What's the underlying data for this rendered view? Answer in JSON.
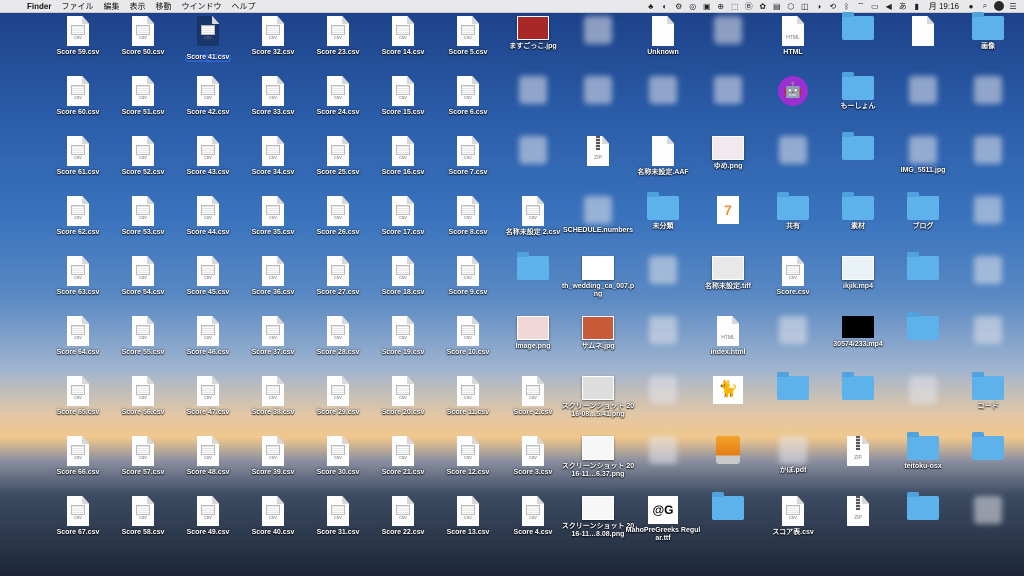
{
  "menubar": {
    "apple": "",
    "app": "Finder",
    "items": [
      "ファイル",
      "編集",
      "表示",
      "移動",
      "ウインドウ",
      "ヘルプ"
    ],
    "clock": "月 19:16"
  },
  "desktop": {
    "items": [
      {
        "label": "Score 59.csv",
        "kind": "csv"
      },
      {
        "label": "Score 50.csv",
        "kind": "csv"
      },
      {
        "label": "Score 41.csv",
        "kind": "csv",
        "selected": true
      },
      {
        "label": "Score 32.csv",
        "kind": "csv"
      },
      {
        "label": "Score 23.csv",
        "kind": "csv"
      },
      {
        "label": "Score 14.csv",
        "kind": "csv"
      },
      {
        "label": "Score 5.csv",
        "kind": "csv"
      },
      {
        "label": "Score 60.csv",
        "kind": "csv"
      },
      {
        "label": "Score 51.csv",
        "kind": "csv"
      },
      {
        "label": "Score 42.csv",
        "kind": "csv"
      },
      {
        "label": "Score 33.csv",
        "kind": "csv"
      },
      {
        "label": "Score 24.csv",
        "kind": "csv"
      },
      {
        "label": "Score 15.csv",
        "kind": "csv"
      },
      {
        "label": "Score 6.csv",
        "kind": "csv"
      },
      {
        "label": "Score 61.csv",
        "kind": "csv"
      },
      {
        "label": "Score 52.csv",
        "kind": "csv"
      },
      {
        "label": "Score 43.csv",
        "kind": "csv"
      },
      {
        "label": "Score 34.csv",
        "kind": "csv"
      },
      {
        "label": "Score 25.csv",
        "kind": "csv"
      },
      {
        "label": "Score 16.csv",
        "kind": "csv"
      },
      {
        "label": "Score 7.csv",
        "kind": "csv"
      },
      {
        "label": "Score 62.csv",
        "kind": "csv"
      },
      {
        "label": "Score 53.csv",
        "kind": "csv"
      },
      {
        "label": "Score 44.csv",
        "kind": "csv"
      },
      {
        "label": "Score 35.csv",
        "kind": "csv"
      },
      {
        "label": "Score 26.csv",
        "kind": "csv"
      },
      {
        "label": "Score 17.csv",
        "kind": "csv"
      },
      {
        "label": "Score 8.csv",
        "kind": "csv"
      },
      {
        "label": "Score 63.csv",
        "kind": "csv"
      },
      {
        "label": "Score 54.csv",
        "kind": "csv"
      },
      {
        "label": "Score 45.csv",
        "kind": "csv"
      },
      {
        "label": "Score 36.csv",
        "kind": "csv"
      },
      {
        "label": "Score 27.csv",
        "kind": "csv"
      },
      {
        "label": "Score 18.csv",
        "kind": "csv"
      },
      {
        "label": "Score 9.csv",
        "kind": "csv"
      },
      {
        "label": "Score 64.csv",
        "kind": "csv"
      },
      {
        "label": "Score 55.csv",
        "kind": "csv"
      },
      {
        "label": "Score 46.csv",
        "kind": "csv"
      },
      {
        "label": "Score 37.csv",
        "kind": "csv"
      },
      {
        "label": "Score 28.csv",
        "kind": "csv"
      },
      {
        "label": "Score 19.csv",
        "kind": "csv"
      },
      {
        "label": "Score 10.csv",
        "kind": "csv"
      },
      {
        "label": "Score 65.csv",
        "kind": "csv"
      },
      {
        "label": "Score 56.csv",
        "kind": "csv"
      },
      {
        "label": "Score 47.csv",
        "kind": "csv"
      },
      {
        "label": "Score 38.csv",
        "kind": "csv"
      },
      {
        "label": "Score 29.csv",
        "kind": "csv"
      },
      {
        "label": "Score 20.csv",
        "kind": "csv"
      },
      {
        "label": "Score 11.csv",
        "kind": "csv"
      },
      {
        "label": "Score 66.csv",
        "kind": "csv"
      },
      {
        "label": "Score 57.csv",
        "kind": "csv"
      },
      {
        "label": "Score 48.csv",
        "kind": "csv"
      },
      {
        "label": "Score 39.csv",
        "kind": "csv"
      },
      {
        "label": "Score 30.csv",
        "kind": "csv"
      },
      {
        "label": "Score 21.csv",
        "kind": "csv"
      },
      {
        "label": "Score 12.csv",
        "kind": "csv"
      },
      {
        "label": "Score 67.csv",
        "kind": "csv"
      },
      {
        "label": "Score 58.csv",
        "kind": "csv"
      },
      {
        "label": "Score 49.csv",
        "kind": "csv"
      },
      {
        "label": "Score 40.csv",
        "kind": "csv"
      },
      {
        "label": "Score 31.csv",
        "kind": "csv"
      },
      {
        "label": "Score 22.csv",
        "kind": "csv"
      },
      {
        "label": "Score 13.csv",
        "kind": "csv"
      },
      {
        "label": "ますごっこ.jpg",
        "kind": "image",
        "color": "#a82828"
      },
      {
        "label": "",
        "kind": "blur"
      },
      {
        "label": "",
        "kind": "blur"
      },
      {
        "label": "名称未設定 2.csv",
        "kind": "csv"
      },
      {
        "label": "",
        "kind": "folder"
      },
      {
        "label": "Image.png",
        "kind": "image",
        "color": "#f1d7d7"
      },
      {
        "label": "Score 2.csv",
        "kind": "csv"
      },
      {
        "label": "Score 3.csv",
        "kind": "csv"
      },
      {
        "label": "Score 4.csv",
        "kind": "csv"
      },
      {
        "label": "",
        "kind": "blur"
      },
      {
        "label": "",
        "kind": "blur"
      },
      {
        "label": "",
        "kind": "zip"
      },
      {
        "label": "SCHEDULE.numbers",
        "kind": "blur"
      },
      {
        "label": "th_wedding_ca_007.png",
        "kind": "image",
        "color": "#ffffff"
      },
      {
        "label": "サムネ.jpg",
        "kind": "image",
        "color": "#c95b3a"
      },
      {
        "label": "スクリーンショット 2016-08…5.41.png",
        "kind": "image",
        "color": "#dddddd"
      },
      {
        "label": "スクリーンショット 2016-11…6.37.png",
        "kind": "image",
        "color": "#f7f7f7"
      },
      {
        "label": "スクリーンショット 2016-11…8.08.png",
        "kind": "image",
        "color": "#f7f7f7"
      },
      {
        "label": "Unknown",
        "kind": "doc"
      },
      {
        "label": "",
        "kind": "blur"
      },
      {
        "label": "名称未設定.AAF",
        "kind": "doc"
      },
      {
        "label": "未分類",
        "kind": "folder"
      },
      {
        "label": "",
        "kind": "blur"
      },
      {
        "label": "",
        "kind": "blur"
      },
      {
        "label": "",
        "kind": "blur"
      },
      {
        "label": "",
        "kind": "blur"
      },
      {
        "label": "MahoPreGreeks Regular.ttf",
        "kind": "font"
      },
      {
        "label": "",
        "kind": "blur"
      },
      {
        "label": "",
        "kind": "blur"
      },
      {
        "label": "ゆめ.png",
        "kind": "image",
        "color": "#f2e8f0"
      },
      {
        "label": "",
        "kind": "pages"
      },
      {
        "label": "名称未設定.tiff",
        "kind": "image",
        "color": "#e8e8e8"
      },
      {
        "label": "index.html",
        "kind": "html"
      },
      {
        "label": "",
        "kind": "cat"
      },
      {
        "label": "",
        "kind": "drive"
      },
      {
        "label": "",
        "kind": "folder"
      },
      {
        "label": "HTML",
        "kind": "html"
      },
      {
        "label": "",
        "kind": "android"
      },
      {
        "label": "",
        "kind": "blur"
      },
      {
        "label": "共有",
        "kind": "folder"
      },
      {
        "label": "Score.csv",
        "kind": "csv"
      },
      {
        "label": "",
        "kind": "blur"
      },
      {
        "label": "",
        "kind": "folder"
      },
      {
        "label": "かぼ.pdf",
        "kind": "blur"
      },
      {
        "label": "スコア表.csv",
        "kind": "csv"
      },
      {
        "label": "",
        "kind": "folder"
      },
      {
        "label": "もーしょん",
        "kind": "folder"
      },
      {
        "label": "",
        "kind": "folder"
      },
      {
        "label": "素材",
        "kind": "folder"
      },
      {
        "label": "ikjik.mp4",
        "kind": "image",
        "color": "#e9f2f7"
      },
      {
        "label": "30574/233.mp4",
        "kind": "video"
      },
      {
        "label": "",
        "kind": "folder"
      },
      {
        "label": "",
        "kind": "zip"
      },
      {
        "label": "",
        "kind": "zip"
      },
      {
        "label": "",
        "kind": "doc"
      },
      {
        "label": "",
        "kind": "blur"
      },
      {
        "label": "IMG_5511.jpg",
        "kind": "blur"
      },
      {
        "label": "ブログ",
        "kind": "folder"
      },
      {
        "label": "",
        "kind": "folder"
      },
      {
        "label": "",
        "kind": "folder"
      },
      {
        "label": "",
        "kind": "blur"
      },
      {
        "label": "teitoku-osx",
        "kind": "folder"
      },
      {
        "label": "",
        "kind": "folder"
      },
      {
        "label": "画像",
        "kind": "folder"
      },
      {
        "label": "",
        "kind": "blur"
      },
      {
        "label": "",
        "kind": "blur"
      },
      {
        "label": "",
        "kind": "blur"
      },
      {
        "label": "",
        "kind": "blur"
      },
      {
        "label": "",
        "kind": "blur"
      },
      {
        "label": "コード",
        "kind": "folder"
      },
      {
        "label": "",
        "kind": "folder"
      },
      {
        "label": "",
        "kind": "blur"
      }
    ]
  }
}
